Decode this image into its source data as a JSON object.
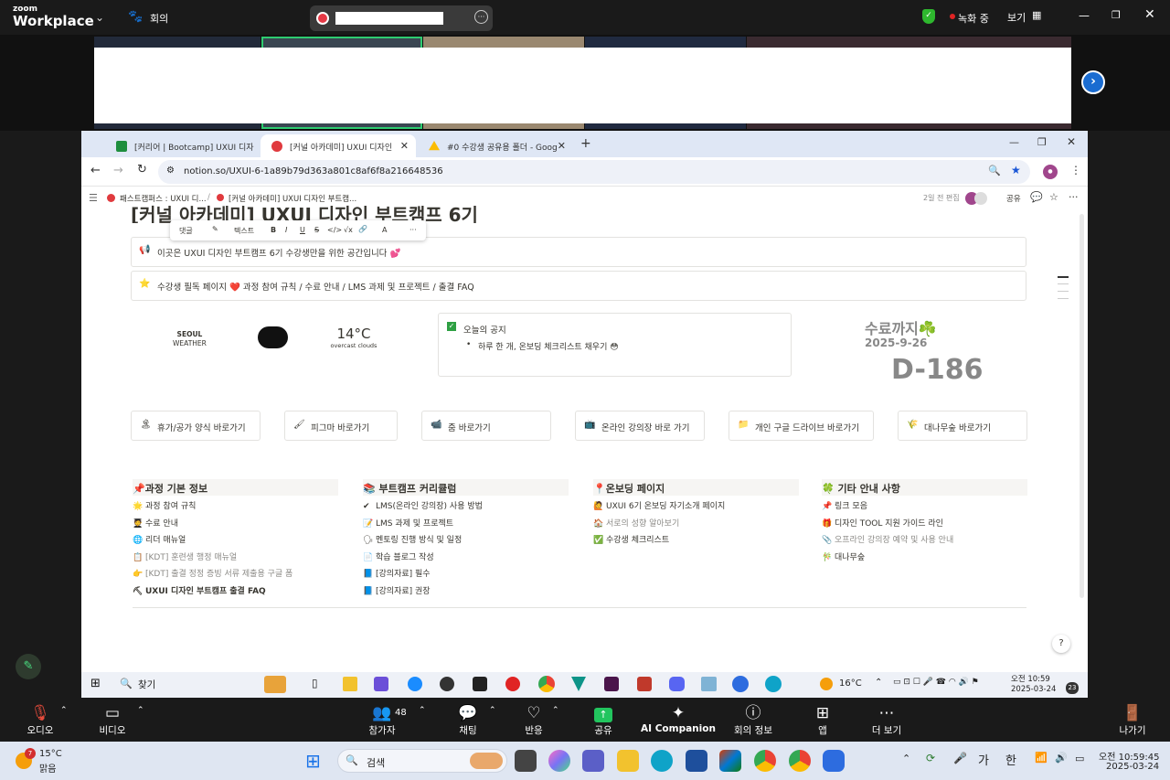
{
  "zoom": {
    "brand_top": "zoom",
    "brand_bottom": "Workplace",
    "meeting": "회의",
    "recording": "녹화 중",
    "view": "보기"
  },
  "browser": {
    "tabs": [
      {
        "label": "[커리어 | Bootcamp] UXUI 디자",
        "color": "#1e8e3e"
      },
      {
        "label": "[커널 아카데미] UXUI 디자인",
        "color": "#e03a3e"
      },
      {
        "label": "#0 수강생 공유용 폴더 - Goog",
        "color": "#fbbc04"
      }
    ],
    "url": "notion.so/UXUI-6-1a89b79d363a801c8af6f8a216648536"
  },
  "notion": {
    "breadcrumb1": "패스트캠퍼스 : UXUI 디...",
    "breadcrumb2": "[커널 아카데미] UXUI 디자인 부트캠...",
    "edited": "2일 전 편집",
    "share": "공유",
    "page_title": "[커널 아카데미] UXUI 디자인 부트캠프 6기",
    "toolbar": {
      "comment": "댓글",
      "text": "텍스트",
      "bold": "B",
      "italic": "I",
      "underline": "U",
      "strike": "S",
      "code": "</>",
      "math": "√x",
      "color": "A",
      "more": "···"
    },
    "callout1": "이곳은 UXUI 디자인 부트캠프 6기 수강생만을 위한 공간입니다 💕",
    "callout2": "수강생 필독 페이지 ❤️ 과정 참여 규칙 / 수료 안내 / LMS 과제 및 프로젝트 / 출결 FAQ",
    "weather": {
      "city": "SEOUL",
      "label": "WEATHER",
      "temp": "14°C",
      "desc": "overcast clouds"
    },
    "notice": {
      "title": "오늘의 공지",
      "item": "하루 한 개, 온보딩 체크리스트 채우기 😳"
    },
    "countdown": {
      "title": "수료까지☘️",
      "date": "2025-9-26",
      "dday": "D-186"
    },
    "links": [
      {
        "icon": "🏝",
        "label": "휴가/공가 양식 바로가기"
      },
      {
        "icon": "🖌",
        "label": "피그마 바로가기"
      },
      {
        "icon": "📹",
        "label": "줌 바로가기"
      },
      {
        "icon": "📺",
        "label": "온라인 강의장 바로 가기"
      },
      {
        "icon": "📁",
        "label": "개인 구글 드라이브 바로가기"
      },
      {
        "icon": "🌾",
        "label": "대나무숲 바로가기"
      }
    ],
    "columns": [
      {
        "header": "📌과정 기본 정보",
        "items": [
          {
            "icon": "🌟",
            "label": "과정 참여 규칙",
            "faded": false
          },
          {
            "icon": "🧑‍🎓",
            "label": "수료 안내",
            "faded": false
          },
          {
            "icon": "🌐",
            "label": "리더 매뉴얼",
            "faded": false
          },
          {
            "icon": "📋",
            "label": "[KDT] 훈련생 행정 매뉴얼",
            "faded": true
          },
          {
            "icon": "👉",
            "label": "[KDT] 출결 정정 증빙 서류 제출용 구글 폼",
            "faded": true
          },
          {
            "icon": "⛏",
            "label": "UXUI 디자인 부트캠프 출결 FAQ",
            "faded": false
          }
        ]
      },
      {
        "header": "📚 부트캠프 커리큘럼",
        "items": [
          {
            "icon": "✔",
            "label": "LMS(온라인 강의장) 사용 방법",
            "faded": false
          },
          {
            "icon": "📝",
            "label": "LMS 과제 및 프로젝트",
            "faded": false
          },
          {
            "icon": "🗣",
            "label": "멘토링 진행 방식 및 일정",
            "faded": false
          },
          {
            "icon": "📄",
            "label": "학습 블로그 작성",
            "faded": false
          },
          {
            "icon": "📘",
            "label": "[강의자료] 필수",
            "faded": false
          },
          {
            "icon": "📘",
            "label": "[강의자료] 권장",
            "faded": false
          }
        ]
      },
      {
        "header": "📍온보딩 페이지",
        "items": [
          {
            "icon": "🙋",
            "label": "UXUI 6기 온보딩 자기소개 페이지",
            "faded": false
          },
          {
            "icon": "🏠",
            "label": "서로의 성향 알아보기",
            "faded": true
          },
          {
            "icon": "✅",
            "label": "수강생 체크리스트",
            "faded": false
          }
        ]
      },
      {
        "header": "🍀 기타 안내 사항",
        "items": [
          {
            "icon": "📌",
            "label": "링크 모음",
            "faded": false
          },
          {
            "icon": "🎁",
            "label": "디자인 TOOL 지원 가이드 라인",
            "faded": false
          },
          {
            "icon": "📎",
            "label": "오프라인 강의장 예약 및 사용 안내",
            "faded": true
          },
          {
            "icon": "🎋",
            "label": "대나무숲",
            "faded": false
          }
        ]
      }
    ]
  },
  "remote_taskbar": {
    "search": "찾기",
    "temp": "16°C",
    "time": "오전 10:59",
    "date": "2025-03-24",
    "badge": "23"
  },
  "zoom_controls": {
    "audio": "오디오",
    "video": "비디오",
    "participants": "참가자",
    "participants_count": "48",
    "chat": "채팅",
    "reactions": "반응",
    "share": "공유",
    "companion": "AI Companion",
    "info": "회의 정보",
    "apps": "앱",
    "more": "더 보기",
    "leave": "나가기"
  },
  "host_taskbar": {
    "weather_temp": "15°C",
    "weather_desc": "맑음",
    "weather_badge": "7",
    "search": "검색",
    "ime1": "가",
    "ime2": "한",
    "time": "오전 10:59:45",
    "date": "2025-03-24"
  }
}
